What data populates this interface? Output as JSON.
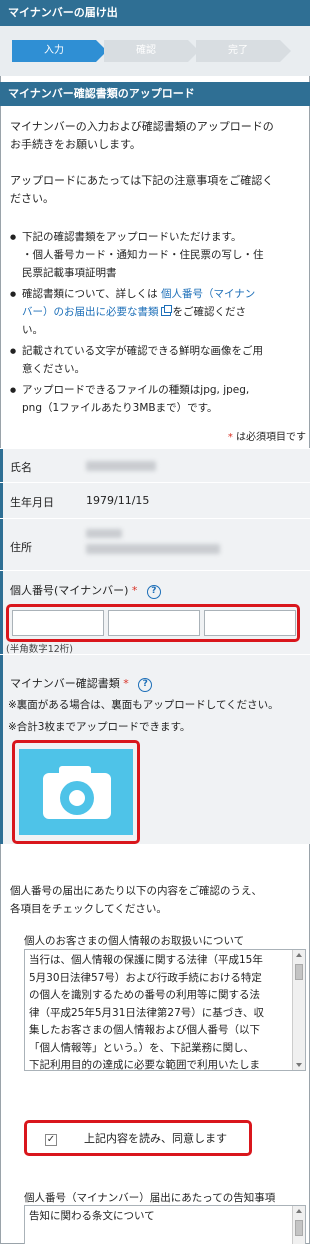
{
  "header": {
    "title": "マイナンバーの届け出"
  },
  "steps": [
    {
      "label": "入力",
      "active": true
    },
    {
      "label": "確認",
      "active": false
    },
    {
      "label": "完了",
      "active": false
    }
  ],
  "section_title": "マイナンバー確認書類のアップロード",
  "intro": {
    "line1": "マイナンバーの入力および確認書類のアップロードの",
    "line2": "お手続きをお願いします。",
    "line3": "アップロードにあたっては下記の注意事項をご確認く",
    "line4": "ださい。"
  },
  "notes": {
    "b1_line1": "下記の確認書類をアップロードいただけます。",
    "b1_line2": "・個人番号カード・通知カード・住民票の写し・住",
    "b1_line3": "民票記載事項証明書",
    "b2_pre": "確認書類について、詳しくは",
    "b2_link1": "個人番号（マイナン",
    "b2_link2": "バー）のお届出に必要な書類",
    "b2_post": "をご確認くださ",
    "b2_line3": "い。",
    "b3_line1": "記載されている文字が確認できる鮮明な画像をご用",
    "b3_line2": "意ください。",
    "b4_line1": "アップロードできるファイルの種類はjpg, jpeg,",
    "b4_line2": "png（1ファイルあたり3MBまで）です。"
  },
  "required_note": {
    "mark": "*",
    "text": "は必須項目です"
  },
  "form": {
    "name_label": "氏名",
    "dob_label": "生年月日",
    "dob_value": "1979/11/15",
    "address_label": "住所",
    "mynumber_label": "個人番号(マイナンバー)",
    "required_mark": "*",
    "help_glyph": "?",
    "mynumber_hint": "(半角数字12桁)",
    "doc_label": "マイナンバー確認書類",
    "doc_note1": "※裏面がある場合は、裏面もアップロードしてください。",
    "doc_note2": "※合計3枚までアップロードできます。"
  },
  "consent": {
    "intro_line1": "個人番号の届出にあたり以下の内容をご確認のうえ、",
    "intro_line2": "各項目をチェックしてください。",
    "privacy_heading": "個人のお客さまの個人情報のお取扱いについて",
    "privacy_lines": [
      "当行は、個人情報の保護に関する法律（平成15年",
      "5月30日法律57号）および行政手続における特定",
      "の個人を識別するための番号の利用等に関する法",
      "律（平成25年5月31日法律第27号）に基づき、収",
      "集したお客さまの個人情報および個人番号（以下",
      "「個人情報等」という。）を、下記業務に関し、",
      "下記利用目的の達成に必要な範囲で利用いたしま"
    ],
    "agree_label": "上記内容を読み、同意します",
    "agree_checked": "✓",
    "notice_heading": "個人番号（マイナンバー）届出にあたっての告知事項",
    "notice_line1": "告知に関わる条文について"
  },
  "colors": {
    "primary": "#2f6f94",
    "step_active": "#2f8fd4",
    "step_inactive": "#d8dde1",
    "highlight": "#d9161c",
    "camera": "#4ec3e8"
  }
}
